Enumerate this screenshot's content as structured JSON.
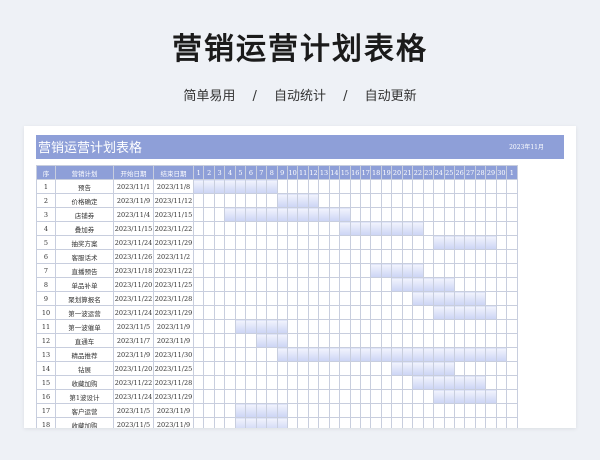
{
  "page": {
    "title": "营销运营计划表格",
    "subtitle": "简单易用　 /　 自动统计　 /　 自动更新"
  },
  "sheet": {
    "title": "营销运营计划表格",
    "month": "2023年11月",
    "headers": {
      "no": "序",
      "plan": "营销计划",
      "start": "开始日期",
      "end": "结束日期"
    },
    "days": [
      "1",
      "2",
      "3",
      "4",
      "5",
      "6",
      "7",
      "8",
      "9",
      "10",
      "11",
      "12",
      "13",
      "14",
      "15",
      "16",
      "17",
      "18",
      "19",
      "20",
      "21",
      "22",
      "23",
      "24",
      "25",
      "26",
      "27",
      "28",
      "29",
      "30",
      "1"
    ],
    "rows": [
      {
        "no": "1",
        "plan": "预告",
        "start": "2023/11/1",
        "end": "2023/11/8",
        "bar": [
          1,
          8
        ]
      },
      {
        "no": "2",
        "plan": "价格确定",
        "start": "2023/11/9",
        "end": "2023/11/12",
        "bar": [
          9,
          12
        ]
      },
      {
        "no": "3",
        "plan": "店铺券",
        "start": "2023/11/4",
        "end": "2023/11/15",
        "bar": [
          4,
          15
        ]
      },
      {
        "no": "4",
        "plan": "叠加券",
        "start": "2023/11/15",
        "end": "2023/11/22",
        "bar": [
          15,
          22
        ]
      },
      {
        "no": "5",
        "plan": "抽奖方案",
        "start": "2023/11/24",
        "end": "2023/11/29",
        "bar": [
          24,
          29
        ]
      },
      {
        "no": "6",
        "plan": "客服话术",
        "start": "2023/11/26",
        "end": "2023/11/2",
        "bar": null
      },
      {
        "no": "7",
        "plan": "直播预告",
        "start": "2023/11/18",
        "end": "2023/11/22",
        "bar": [
          18,
          22
        ]
      },
      {
        "no": "8",
        "plan": "单品补单",
        "start": "2023/11/20",
        "end": "2023/11/25",
        "bar": [
          20,
          25
        ]
      },
      {
        "no": "9",
        "plan": "聚划算报名",
        "start": "2023/11/22",
        "end": "2023/11/28",
        "bar": [
          22,
          28
        ]
      },
      {
        "no": "10",
        "plan": "第一波运营",
        "start": "2023/11/24",
        "end": "2023/11/29",
        "bar": [
          24,
          29
        ]
      },
      {
        "no": "11",
        "plan": "第一波催单",
        "start": "2023/11/5",
        "end": "2023/11/9",
        "bar": [
          5,
          9
        ]
      },
      {
        "no": "12",
        "plan": "直通车",
        "start": "2023/11/7",
        "end": "2023/11/9",
        "bar": [
          7,
          9
        ]
      },
      {
        "no": "13",
        "plan": "精品推荐",
        "start": "2023/11/9",
        "end": "2023/11/30",
        "bar": [
          9,
          30
        ]
      },
      {
        "no": "14",
        "plan": "钻展",
        "start": "2023/11/20",
        "end": "2023/11/25",
        "bar": [
          20,
          25
        ]
      },
      {
        "no": "15",
        "plan": "收藏加购",
        "start": "2023/11/22",
        "end": "2023/11/28",
        "bar": [
          22,
          28
        ]
      },
      {
        "no": "16",
        "plan": "第1波设计",
        "start": "2023/11/24",
        "end": "2023/11/29",
        "bar": [
          24,
          29
        ]
      },
      {
        "no": "17",
        "plan": "客户运营",
        "start": "2023/11/5",
        "end": "2023/11/9",
        "bar": [
          5,
          9
        ]
      },
      {
        "no": "18",
        "plan": "收藏加购",
        "start": "2023/11/5",
        "end": "2023/11/9",
        "bar": [
          5,
          9
        ]
      }
    ]
  }
}
